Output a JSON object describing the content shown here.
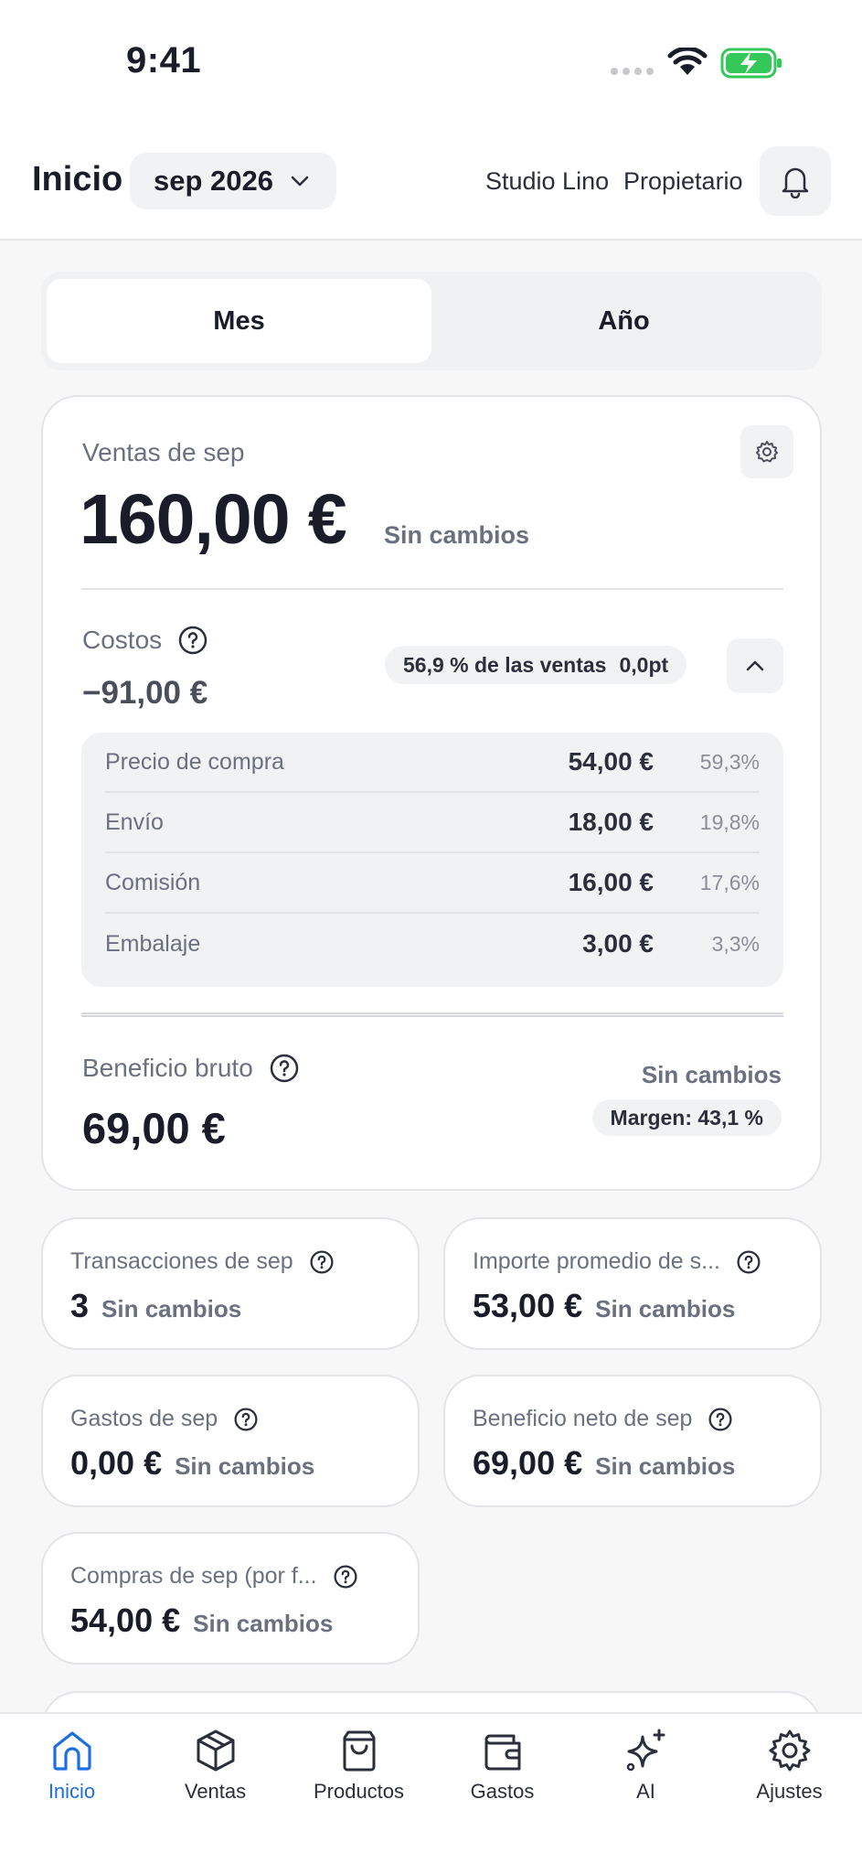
{
  "status_bar": {
    "time": "9:41"
  },
  "header": {
    "title": "Inicio",
    "period": "sep 2026",
    "store_name": "Studio Lino",
    "role": "Propietario"
  },
  "segment": {
    "month": "Mes",
    "year": "Año",
    "selected": "Mes"
  },
  "sales": {
    "label": "Ventas de sep",
    "value": "160,00 €",
    "change": "Sin cambios"
  },
  "costs": {
    "label": "Costos",
    "value": "−91,00 €",
    "share_label": "56,9 % de las ventas",
    "delta": "0,0pt",
    "breakdown": [
      {
        "name": "Precio de compra",
        "amount": "54,00 €",
        "pct": "59,3%"
      },
      {
        "name": "Envío",
        "amount": "18,00 €",
        "pct": "19,8%"
      },
      {
        "name": "Comisión",
        "amount": "16,00 €",
        "pct": "17,6%"
      },
      {
        "name": "Embalaje",
        "amount": "3,00 €",
        "pct": "3,3%"
      }
    ]
  },
  "gross_profit": {
    "label": "Beneficio bruto",
    "value": "69,00 €",
    "change": "Sin cambios",
    "margin": "Margen: 43,1 %"
  },
  "metrics": [
    {
      "label": "Transacciones de sep",
      "value": "3",
      "change": "Sin cambios"
    },
    {
      "label": "Importe promedio de s...",
      "value": "53,00 €",
      "change": "Sin cambios"
    },
    {
      "label": "Gastos de sep",
      "value": "0,00 €",
      "change": "Sin cambios"
    },
    {
      "label": "Beneficio neto de sep",
      "value": "69,00 €",
      "change": "Sin cambios"
    },
    {
      "label": "Compras de sep (por f...",
      "value": "54,00 €",
      "change": "Sin cambios"
    }
  ],
  "tabs": [
    {
      "label": "Inicio",
      "icon": "home-icon",
      "active": true
    },
    {
      "label": "Ventas",
      "icon": "box-icon",
      "active": false
    },
    {
      "label": "Productos",
      "icon": "shopping-bag-icon",
      "active": false
    },
    {
      "label": "Gastos",
      "icon": "wallet-icon",
      "active": false
    },
    {
      "label": "AI",
      "icon": "sparkles-icon",
      "active": false
    },
    {
      "label": "Ajustes",
      "icon": "gear-icon",
      "active": false
    }
  ],
  "colors": {
    "accent": "#1d6fe0",
    "text": "#1a1d29",
    "muted": "#6b7080"
  }
}
